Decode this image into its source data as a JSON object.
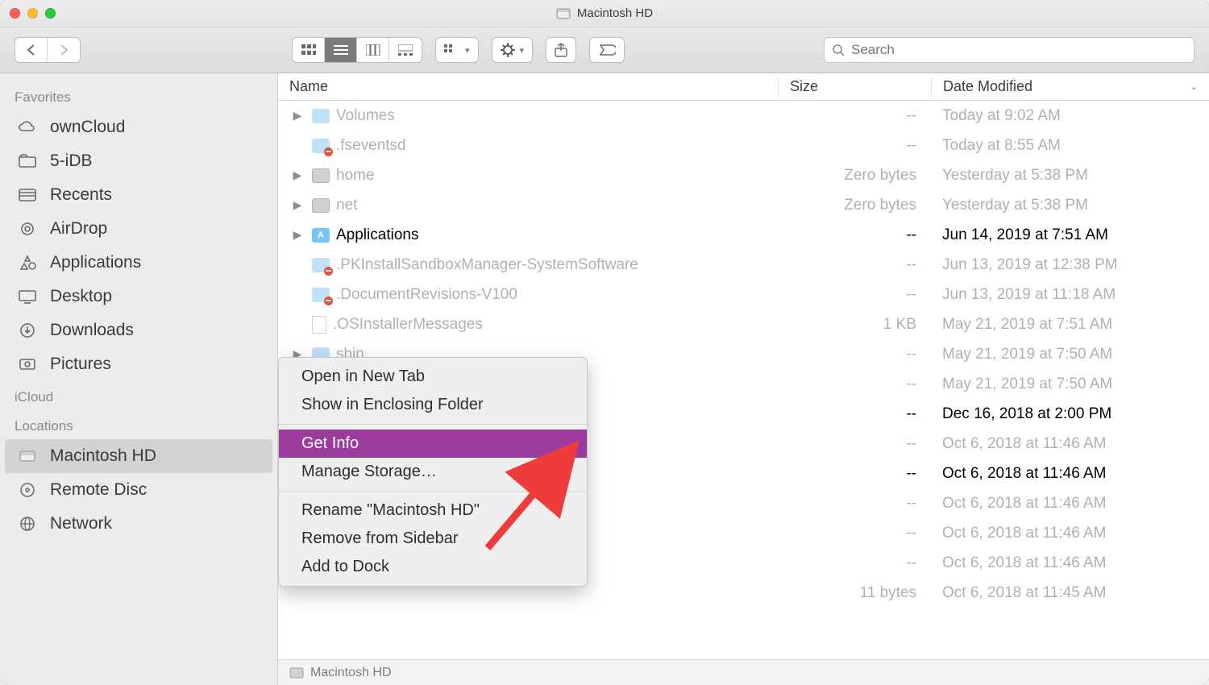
{
  "window": {
    "title": "Macintosh HD"
  },
  "search": {
    "placeholder": "Search"
  },
  "columns": {
    "name": "Name",
    "size": "Size",
    "date": "Date Modified"
  },
  "sidebar": {
    "sections": [
      {
        "title": "Favorites",
        "items": [
          {
            "icon": "cloud-icon",
            "label": "ownCloud"
          },
          {
            "icon": "folder-icon",
            "label": "5-iDB"
          },
          {
            "icon": "recents-icon",
            "label": "Recents"
          },
          {
            "icon": "airdrop-icon",
            "label": "AirDrop"
          },
          {
            "icon": "apps-icon",
            "label": "Applications"
          },
          {
            "icon": "desktop-icon",
            "label": "Desktop"
          },
          {
            "icon": "downloads-icon",
            "label": "Downloads"
          },
          {
            "icon": "pictures-icon",
            "label": "Pictures"
          }
        ]
      },
      {
        "title": "iCloud",
        "items": []
      },
      {
        "title": "Locations",
        "items": [
          {
            "icon": "hd-icon",
            "label": "Macintosh HD",
            "selected": true
          },
          {
            "icon": "disc-icon",
            "label": "Remote Disc"
          },
          {
            "icon": "network-icon",
            "label": "Network"
          }
        ]
      }
    ]
  },
  "rows": [
    {
      "exp": true,
      "dim": true,
      "icon": "folder",
      "name": "Volumes",
      "size": "--",
      "date": "Today at 9:02 AM"
    },
    {
      "exp": false,
      "dim": true,
      "icon": "folder-noentry",
      "name": ".fseventsd",
      "size": "--",
      "date": "Today at 8:55 AM"
    },
    {
      "exp": true,
      "dim": true,
      "icon": "drive",
      "name": "home",
      "size": "Zero bytes",
      "date": "Yesterday at 5:38 PM"
    },
    {
      "exp": true,
      "dim": true,
      "icon": "drive",
      "name": "net",
      "size": "Zero bytes",
      "date": "Yesterday at 5:38 PM"
    },
    {
      "exp": true,
      "dim": false,
      "icon": "folder-apps",
      "name": "Applications",
      "size": "--",
      "date": "Jun 14, 2019 at 7:51 AM"
    },
    {
      "exp": false,
      "dim": true,
      "icon": "folder-noentry",
      "name": ".PKInstallSandboxManager-SystemSoftware",
      "size": "--",
      "date": "Jun 13, 2019 at 12:38 PM"
    },
    {
      "exp": false,
      "dim": true,
      "icon": "folder-noentry",
      "name": ".DocumentRevisions-V100",
      "size": "--",
      "date": "Jun 13, 2019 at 11:18 AM"
    },
    {
      "exp": false,
      "dim": true,
      "icon": "file",
      "name": ".OSInstallerMessages",
      "size": "1 KB",
      "date": "May 21, 2019 at 7:51 AM"
    },
    {
      "exp": true,
      "dim": true,
      "icon": "folder",
      "name": "sbin",
      "size": "--",
      "date": "May 21, 2019 at 7:50 AM"
    },
    {
      "exp": false,
      "dim": true,
      "icon": "",
      "name": "",
      "size": "--",
      "date": "May 21, 2019 at 7:50 AM"
    },
    {
      "exp": false,
      "dim": false,
      "icon": "",
      "name": "",
      "size": "--",
      "date": "Dec 16, 2018 at 2:00 PM"
    },
    {
      "exp": false,
      "dim": true,
      "icon": "",
      "name": "",
      "size": "--",
      "date": "Oct 6, 2018 at 11:46 AM"
    },
    {
      "exp": false,
      "dim": false,
      "icon": "",
      "name": "",
      "size": "--",
      "date": "Oct 6, 2018 at 11:46 AM"
    },
    {
      "exp": false,
      "dim": true,
      "icon": "",
      "name": "",
      "size": "--",
      "date": "Oct 6, 2018 at 11:46 AM"
    },
    {
      "exp": false,
      "dim": true,
      "icon": "",
      "name": "",
      "size": "--",
      "date": "Oct 6, 2018 at 11:46 AM"
    },
    {
      "exp": false,
      "dim": true,
      "icon": "",
      "name": "",
      "size": "--",
      "date": "Oct 6, 2018 at 11:46 AM"
    },
    {
      "exp": false,
      "dim": true,
      "icon": "",
      "name": "",
      "size": "11 bytes",
      "date": "Oct 6, 2018 at 11:45 AM"
    }
  ],
  "context_menu": {
    "items": [
      {
        "label": "Open in New Tab"
      },
      {
        "label": "Show in Enclosing Folder"
      },
      {
        "sep": true
      },
      {
        "label": "Get Info",
        "highlighted": true
      },
      {
        "label": "Manage Storage…"
      },
      {
        "sep": true
      },
      {
        "label": "Rename \"Macintosh HD\""
      },
      {
        "label": "Remove from Sidebar"
      },
      {
        "label": "Add to Dock"
      }
    ]
  },
  "pathbar": {
    "label": "Macintosh HD"
  }
}
